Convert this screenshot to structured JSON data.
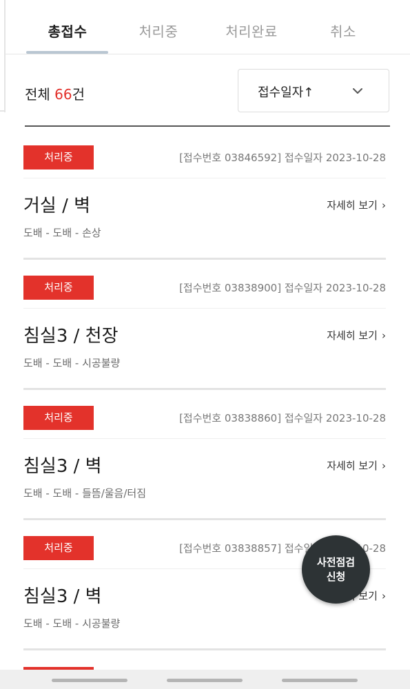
{
  "tabs": [
    {
      "label": "총접수",
      "active": true
    },
    {
      "label": "처리중",
      "active": false
    },
    {
      "label": "처리완료",
      "active": false
    },
    {
      "label": "취소",
      "active": false
    }
  ],
  "summary": {
    "prefix": "전체 ",
    "count": "66",
    "suffix": "건"
  },
  "sort": {
    "selected": "접수일자↑"
  },
  "cards": [
    {
      "badge": "처리중",
      "meta": "[접수번호 03846592] 접수일자 2023-10-28",
      "title": "거실 / 벽",
      "detail": "자세히 보기",
      "sub": "도배 - 도배 - 손상"
    },
    {
      "badge": "처리중",
      "meta": "[접수번호 03838900] 접수일자 2023-10-28",
      "title": "침실3 / 천장",
      "detail": "자세히 보기",
      "sub": "도배 - 도배 - 시공불량"
    },
    {
      "badge": "처리중",
      "meta": "[접수번호 03838860] 접수일자 2023-10-28",
      "title": "침실3 / 벽",
      "detail": "자세히 보기",
      "sub": "도배 - 도배 - 들뜸/울음/터짐"
    },
    {
      "badge": "처리중",
      "meta": "[접수번호 03838857] 접수일자 2023-10-28",
      "title": "침실3 / 벽",
      "detail": "자세히 보기",
      "sub": "도배 - 도배 - 시공불량"
    }
  ],
  "fab": {
    "line1": "사전점검",
    "line2": "신청"
  },
  "colors": {
    "accent": "#e3322b",
    "fab": "#2d3335"
  }
}
